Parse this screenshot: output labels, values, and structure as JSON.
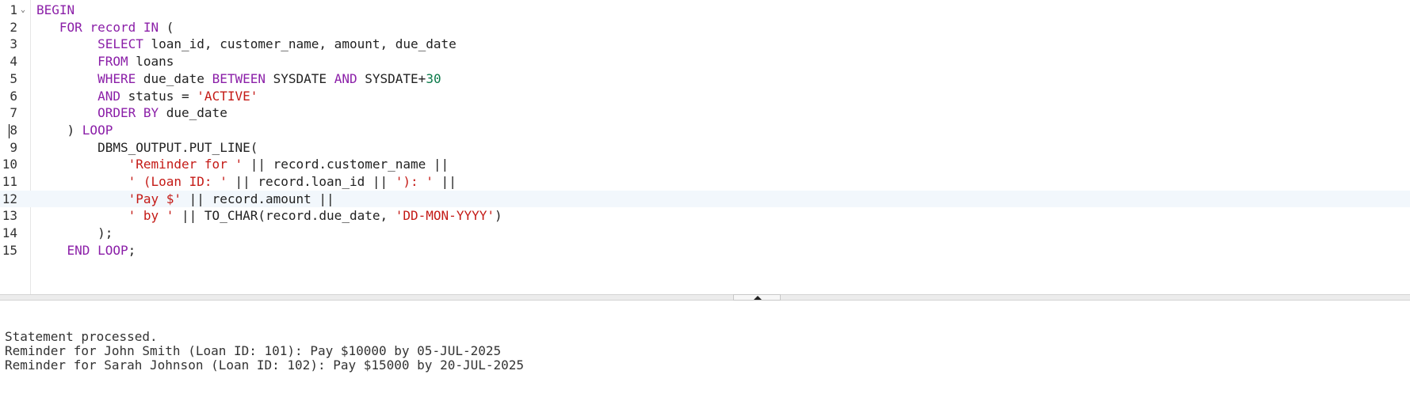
{
  "editor": {
    "lines": [
      {
        "num": "1",
        "fold": "⌄",
        "segments": [
          {
            "t": "BEGIN",
            "c": "kw"
          }
        ]
      },
      {
        "num": "2",
        "segments": [
          {
            "t": "   "
          },
          {
            "t": "FOR",
            "c": "kw"
          },
          {
            "t": " "
          },
          {
            "t": "record",
            "c": "kw"
          },
          {
            "t": " "
          },
          {
            "t": "IN",
            "c": "kw"
          },
          {
            "t": " ("
          }
        ]
      },
      {
        "num": "3",
        "segments": [
          {
            "t": "        "
          },
          {
            "t": "SELECT",
            "c": "kw"
          },
          {
            "t": " loan_id, customer_name, amount, due_date"
          }
        ]
      },
      {
        "num": "4",
        "segments": [
          {
            "t": "        "
          },
          {
            "t": "FROM",
            "c": "kw"
          },
          {
            "t": " loans"
          }
        ]
      },
      {
        "num": "5",
        "segments": [
          {
            "t": "        "
          },
          {
            "t": "WHERE",
            "c": "kw"
          },
          {
            "t": " due_date "
          },
          {
            "t": "BETWEEN",
            "c": "kw"
          },
          {
            "t": " SYSDATE "
          },
          {
            "t": "AND",
            "c": "kw"
          },
          {
            "t": " SYSDATE+"
          },
          {
            "t": "30",
            "c": "num"
          }
        ]
      },
      {
        "num": "6",
        "segments": [
          {
            "t": "        "
          },
          {
            "t": "AND",
            "c": "kw"
          },
          {
            "t": " status = "
          },
          {
            "t": "'ACTIVE'",
            "c": "str"
          }
        ]
      },
      {
        "num": "7",
        "segments": [
          {
            "t": "        "
          },
          {
            "t": "ORDER BY",
            "c": "kw"
          },
          {
            "t": " due_date"
          }
        ]
      },
      {
        "num": "8",
        "caret": true,
        "segments": [
          {
            "t": "    ) "
          },
          {
            "t": "LOOP",
            "c": "kw"
          }
        ]
      },
      {
        "num": "9",
        "segments": [
          {
            "t": "        DBMS_OUTPUT.PUT_LINE("
          }
        ]
      },
      {
        "num": "10",
        "segments": [
          {
            "t": "            "
          },
          {
            "t": "'Reminder for '",
            "c": "str"
          },
          {
            "t": " || record.customer_name ||"
          }
        ]
      },
      {
        "num": "11",
        "segments": [
          {
            "t": "            "
          },
          {
            "t": "' (Loan ID: '",
            "c": "str"
          },
          {
            "t": " || record.loan_id || "
          },
          {
            "t": "'): '",
            "c": "str"
          },
          {
            "t": " ||"
          }
        ]
      },
      {
        "num": "12",
        "active": true,
        "segments": [
          {
            "t": "            "
          },
          {
            "t": "'Pay $'",
            "c": "str"
          },
          {
            "t": " || record.amount ||"
          }
        ]
      },
      {
        "num": "13",
        "segments": [
          {
            "t": "            "
          },
          {
            "t": "' by '",
            "c": "str"
          },
          {
            "t": " || TO_CHAR(record.due_date, "
          },
          {
            "t": "'DD-MON-YYYY'",
            "c": "str"
          },
          {
            "t": ")"
          }
        ]
      },
      {
        "num": "14",
        "segments": [
          {
            "t": "        );"
          }
        ]
      },
      {
        "num": "15",
        "segments": [
          {
            "t": "    "
          },
          {
            "t": "END LOOP",
            "c": "kw"
          },
          {
            "t": ";"
          }
        ]
      }
    ]
  },
  "splitter": {
    "icon": "triangle-up-icon"
  },
  "output": {
    "lines": [
      "Statement processed.",
      "Reminder for John Smith (Loan ID: 101): Pay $10000 by 05-JUL-2025",
      "Reminder for Sarah Johnson (Loan ID: 102): Pay $15000 by 20-JUL-2025"
    ]
  },
  "colors": {
    "keyword": "#8b1fa8",
    "string": "#c41a16",
    "number": "#0b7a4a",
    "active_line": "#f2f7fc"
  }
}
